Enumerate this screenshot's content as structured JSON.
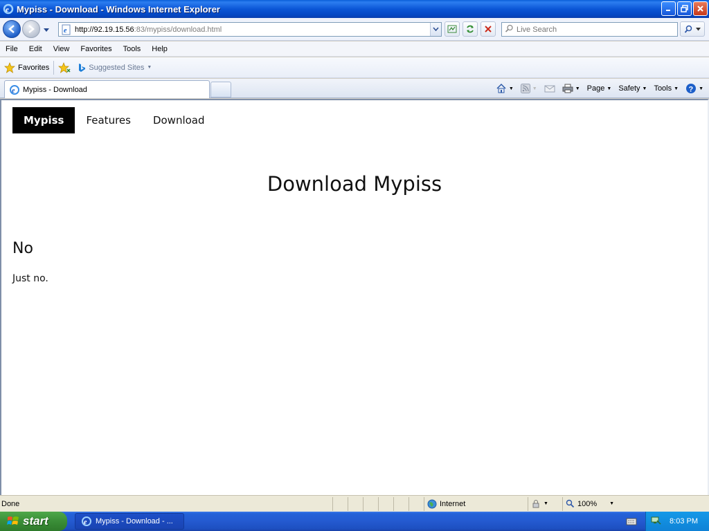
{
  "window": {
    "title": "Mypiss - Download - Windows Internet Explorer"
  },
  "address_bar": {
    "url_host": "http://92.19.15.56",
    "url_rest": ":83/mypiss/download.html"
  },
  "search": {
    "placeholder": "Live Search"
  },
  "menu": {
    "items": [
      "File",
      "Edit",
      "View",
      "Favorites",
      "Tools",
      "Help"
    ]
  },
  "favorites_bar": {
    "favorites_label": "Favorites",
    "suggested_label": "Suggested Sites"
  },
  "tabs": {
    "active_label": "Mypiss - Download"
  },
  "command_bar": {
    "page_label": "Page",
    "safety_label": "Safety",
    "tools_label": "Tools"
  },
  "site": {
    "nav": [
      "Mypiss",
      "Features",
      "Download"
    ],
    "heading": "Download Mypiss",
    "section_title": "No",
    "section_text": "Just no."
  },
  "status": {
    "text": "Done",
    "zone": "Internet",
    "zoom": "100%"
  },
  "taskbar": {
    "start_label": "start",
    "task_label": "Mypiss - Download - ...",
    "clock": "8:03 PM"
  },
  "colors": {
    "titlebar": "#0b56d6",
    "site_nav_active_bg": "#000000",
    "taskbar": "#245ad0",
    "start_button": "#3a8d37"
  }
}
